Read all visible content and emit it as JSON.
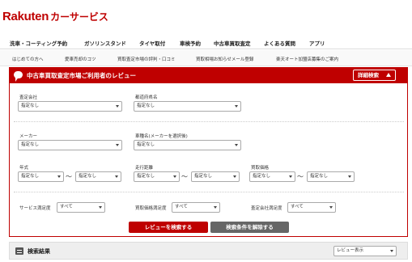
{
  "brand": {
    "name": "Rakuten",
    "service": "カーサービス",
    "color": "#bf0000"
  },
  "nav_primary": [
    "洗車・コーティング予約",
    "ガソリンスタンド",
    "タイヤ取付",
    "車検予約",
    "中古車買取査定",
    "よくある質問",
    "アプリ"
  ],
  "nav_secondary": [
    "はじめての方へ",
    "愛車売却のコツ",
    "買取査定市場の評判・口コミ",
    "買取相場お知らせメール登録",
    "楽天オート加盟店募集のご案内"
  ],
  "panel": {
    "title": "中古車買取査定市場ご利用者のレビュー",
    "advanced_label": "詳細検索"
  },
  "filters": {
    "company": {
      "label": "査定会社",
      "value": "指定なし"
    },
    "prefecture": {
      "label": "都道府県名",
      "value": "指定なし"
    },
    "maker": {
      "label": "メーカー",
      "value": "指定なし"
    },
    "model": {
      "label": "車種名(メーカーを選択後)",
      "value": "指定なし"
    },
    "year": {
      "label": "年式",
      "from": "指定なし",
      "to": "指定なし"
    },
    "mileage": {
      "label": "走行距離",
      "from": "指定なし",
      "to": "指定なし"
    },
    "price": {
      "label": "買取価格",
      "from": "指定なし",
      "to": "指定なし"
    },
    "service_satisfaction": {
      "label": "サービス満足度",
      "value": "すべて"
    },
    "price_satisfaction": {
      "label": "買取価格満足度",
      "value": "すべて"
    },
    "company_satisfaction": {
      "label": "査定会社満足度",
      "value": "すべて"
    },
    "tilde": "〜"
  },
  "buttons": {
    "search": "レビューを検索する",
    "clear": "検索条件を解除する"
  },
  "results": {
    "title": "検索結果",
    "display_value": "レビュー表示"
  }
}
